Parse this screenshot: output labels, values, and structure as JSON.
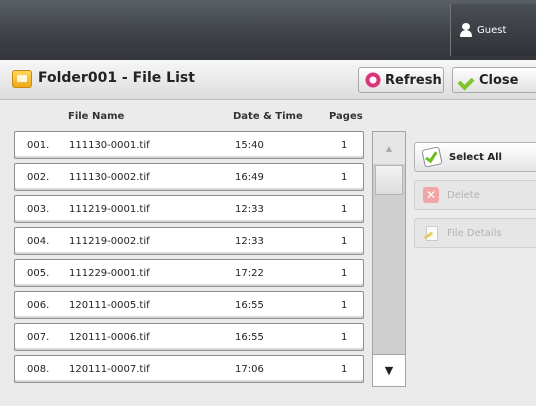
{
  "header": {
    "user_label": "Guest"
  },
  "titlebar": {
    "title": "Folder001 - File List",
    "refresh_label": "Refresh",
    "close_label": "Close"
  },
  "columns": {
    "name": "File Name",
    "date": "Date & Time",
    "pages": "Pages"
  },
  "files": [
    {
      "num": "001.",
      "name": "111130-0001.tif",
      "time": "15:40",
      "pages": "1"
    },
    {
      "num": "002.",
      "name": "111130-0002.tif",
      "time": "16:49",
      "pages": "1"
    },
    {
      "num": "003.",
      "name": "111219-0001.tif",
      "time": "12:33",
      "pages": "1"
    },
    {
      "num": "004.",
      "name": "111219-0002.tif",
      "time": "12:33",
      "pages": "1"
    },
    {
      "num": "005.",
      "name": "111229-0001.tif",
      "time": "17:22",
      "pages": "1"
    },
    {
      "num": "006.",
      "name": "120111-0005.tif",
      "time": "16:55",
      "pages": "1"
    },
    {
      "num": "007.",
      "name": "120111-0006.tif",
      "time": "16:55",
      "pages": "1"
    },
    {
      "num": "008.",
      "name": "120111-0007.tif",
      "time": "17:06",
      "pages": "1"
    }
  ],
  "actions": {
    "select_all_label": "Select All",
    "delete_label": "Delete",
    "file_details_label": "File Details"
  },
  "icons": {
    "user": "user-icon",
    "folder": "folder-icon",
    "refresh": "refresh-icon",
    "close": "checkmark-icon",
    "select_all": "select-all-icon",
    "delete": "delete-icon",
    "file_details": "file-details-icon"
  }
}
